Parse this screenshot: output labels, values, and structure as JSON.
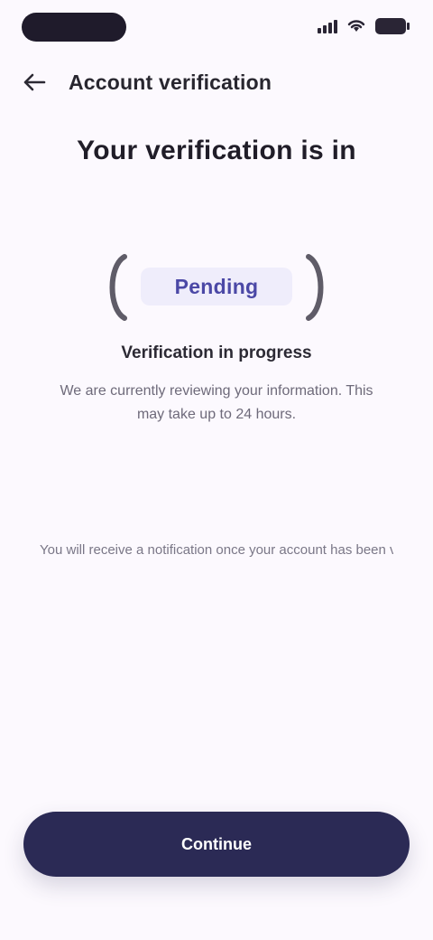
{
  "status_bar": {
    "pill": "",
    "icons": [
      "signal-icon",
      "wifi-icon",
      "battery-icon"
    ]
  },
  "header": {
    "back_icon": "back-arrow-icon",
    "title": "Account verification"
  },
  "page": {
    "title": "Your verification is in",
    "status_badge": "Pending",
    "status_heading": "Verification in progress",
    "status_description": "We are currently reviewing your information. This may take up to 24 hours.",
    "hint": "You will receive a notification once your account has been verified."
  },
  "footer": {
    "primary_button_label": "Continue"
  },
  "colors": {
    "background": "#fcf9fe",
    "primary": "#2b2a55",
    "badge_bg": "#efedfb",
    "badge_text": "#4b48a6"
  }
}
